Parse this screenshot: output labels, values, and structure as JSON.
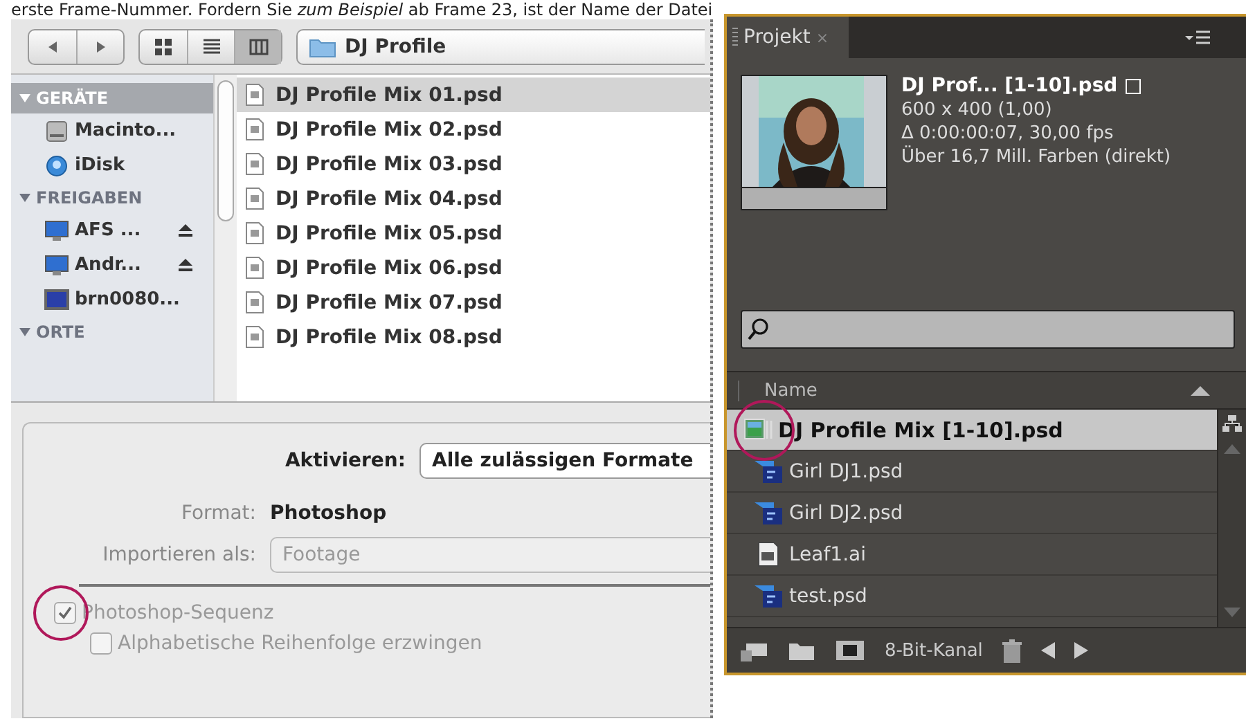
{
  "caption": "erste Frame-Nummer. Fordern Sie *zum Beispiel* ab Frame 23, ist der Name der Datei",
  "file_dialog": {
    "view_modes": [
      {
        "kind": "icons",
        "selected": false
      },
      {
        "kind": "list",
        "selected": false
      },
      {
        "kind": "columns",
        "selected": true
      }
    ],
    "path": "DJ Profile",
    "sidebar": [
      {
        "heading": "GERÄTE",
        "selected": true,
        "items": [
          {
            "label": "Macinto...",
            "kind": "disk",
            "eject": false
          },
          {
            "label": "iDisk",
            "kind": "idisk",
            "eject": false
          }
        ]
      },
      {
        "heading": "FREIGABEN",
        "selected": false,
        "items": [
          {
            "label": "AFS ...",
            "kind": "share",
            "eject": true
          },
          {
            "label": "Andr...",
            "kind": "share",
            "eject": true
          },
          {
            "label": "brn0080...",
            "kind": "monitor",
            "eject": false
          }
        ]
      },
      {
        "heading": "ORTE",
        "selected": false
      }
    ],
    "files": [
      {
        "name": "DJ Profile Mix 01.psd",
        "selected": true
      },
      {
        "name": "DJ Profile Mix 02.psd",
        "selected": false
      },
      {
        "name": "DJ Profile Mix 03.psd",
        "selected": false
      },
      {
        "name": "DJ Profile Mix 04.psd",
        "selected": false
      },
      {
        "name": "DJ Profile Mix 05.psd",
        "selected": false
      },
      {
        "name": "DJ Profile Mix 06.psd",
        "selected": false
      },
      {
        "name": "DJ Profile Mix 07.psd",
        "selected": false
      },
      {
        "name": "DJ Profile Mix 08.psd",
        "selected": false
      }
    ],
    "enable": {
      "label": "Aktivieren:",
      "value": "Alle zulässigen Formate"
    },
    "format": {
      "label": "Format:",
      "value": "Photoshop"
    },
    "import_as": {
      "label": "Importieren als:",
      "value": "Footage",
      "disabled": true
    },
    "options": [
      {
        "label": "Photoshop-Sequenz",
        "checked": true,
        "children": [
          {
            "label": "Alphabetische Reihenfolge erzwingen",
            "checked": false
          }
        ]
      }
    ]
  },
  "project_panel": {
    "tab": "Projekt",
    "close": "×",
    "preview": {
      "title": "DJ Prof... [1-10].psd",
      "lines": [
        "600 x 400 (1,00)",
        "Δ 0:00:00:07, 30,00 fps",
        "Über 16,7 Mill. Farben (direkt)"
      ]
    },
    "column": "Name",
    "items": [
      {
        "name": "DJ Profile Mix [1-10].psd",
        "kind": "sequence",
        "selected": true
      },
      {
        "name": "Girl DJ1.psd",
        "kind": "psd",
        "selected": false
      },
      {
        "name": "Girl DJ2.psd",
        "kind": "psd",
        "selected": false
      },
      {
        "name": "Leaf1.ai",
        "kind": "ai",
        "selected": false
      },
      {
        "name": "test.psd",
        "kind": "psd",
        "selected": false
      }
    ],
    "bit_depth": "8-Bit-Kanal"
  }
}
